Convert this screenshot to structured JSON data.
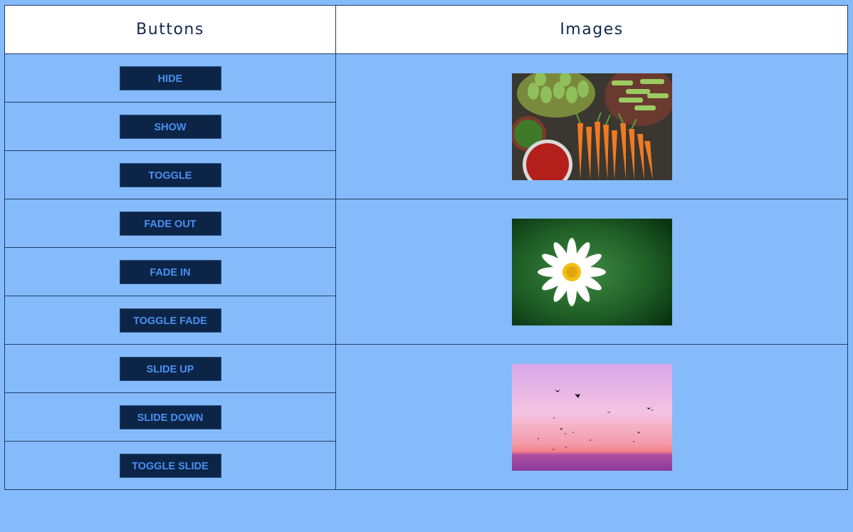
{
  "header": {
    "buttons_label": "Buttons",
    "images_label": "Images"
  },
  "groups": [
    {
      "buttons": [
        "HIDE",
        "SHOW",
        "TOGGLE"
      ],
      "image_icon": "vegetables-image"
    },
    {
      "buttons": [
        "FADE OUT",
        "FADE IN",
        "TOGGLE FADE"
      ],
      "image_icon": "daisy-flower-image"
    },
    {
      "buttons": [
        "SLIDE UP",
        "SLIDE DOWN",
        "TOGGLE SLIDE"
      ],
      "image_icon": "birds-sunset-image"
    }
  ],
  "colors": {
    "page_background": "#85bbfb",
    "header_background": "#ffffff",
    "button_background": "#0c2547",
    "button_text": "#4a8ff0",
    "border": "#1f3d66"
  }
}
